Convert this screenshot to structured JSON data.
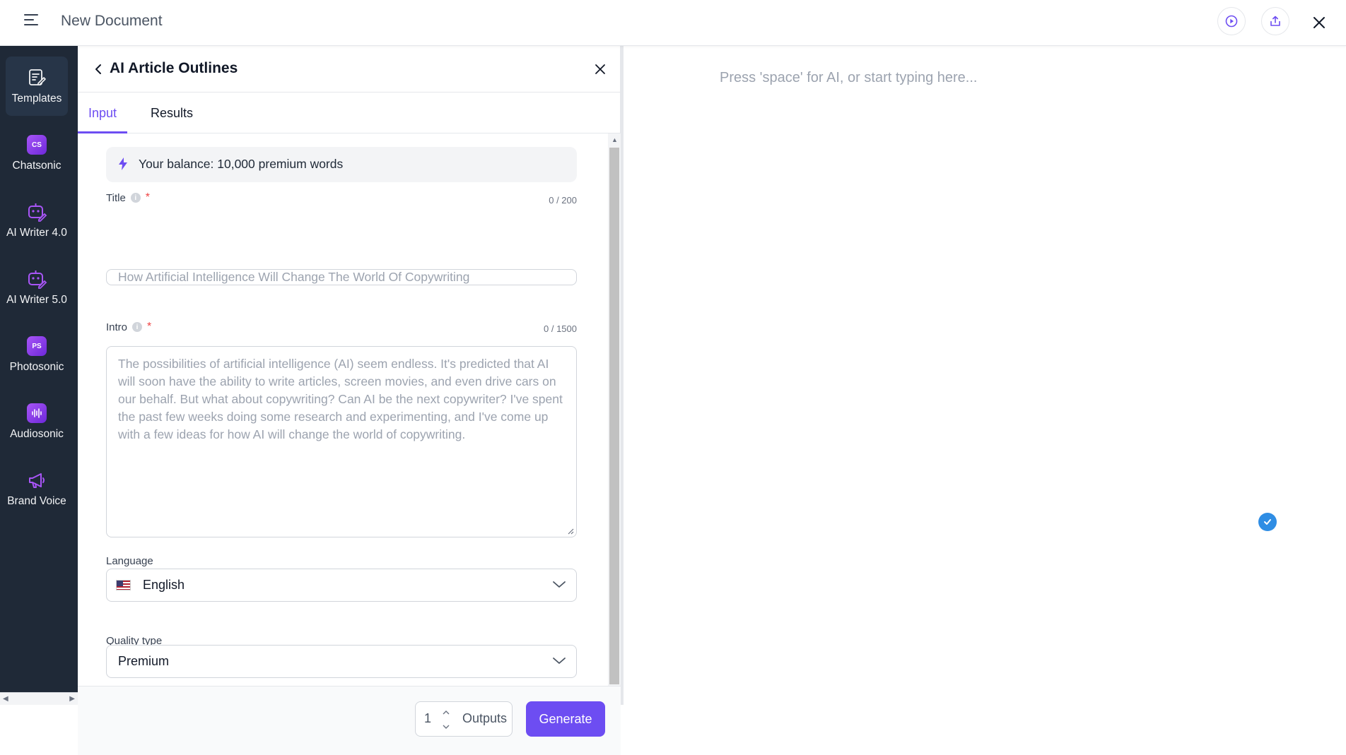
{
  "header": {
    "title": "New Document",
    "icons": [
      "menu-icon",
      "play-icon",
      "share-icon",
      "close-icon"
    ]
  },
  "sidebar": {
    "items": [
      {
        "label": "Templates",
        "icon": "templates-icon",
        "active": true
      },
      {
        "label": "Chatsonic",
        "icon": "cs",
        "active": false
      },
      {
        "label": "AI Writer 4.0",
        "icon": "ai-writer-icon",
        "active": false
      },
      {
        "label": "AI Writer 5.0",
        "icon": "ai-writer-icon",
        "active": false
      },
      {
        "label": "Photosonic",
        "icon": "ps",
        "active": false
      },
      {
        "label": "Audiosonic",
        "icon": "audio-icon",
        "active": false
      },
      {
        "label": "Brand Voice",
        "icon": "megaphone-icon",
        "active": false
      }
    ]
  },
  "panel": {
    "title": "AI Article Outlines",
    "tabs": [
      {
        "label": "Input",
        "active": true
      },
      {
        "label": "Results",
        "active": false
      }
    ],
    "balance": "Your balance: 10,000 premium words",
    "title_field": {
      "label": "Title",
      "required": "*",
      "counter": "0 / 200",
      "placeholder": "How Artificial Intelligence Will Change The World Of Copywriting"
    },
    "intro_field": {
      "label": "Intro",
      "required": "*",
      "counter": "0 / 1500",
      "placeholder": "The possibilities of artificial intelligence (AI) seem endless. It's predicted that AI will soon have the ability to write articles, screen movies, and even drive cars on our behalf. But what about copywriting? Can AI be the next copywriter? I've spent the past few weeks doing some research and experimenting, and I've come up with a few ideas for how AI will change the world of copywriting."
    },
    "language": {
      "label": "Language",
      "value": "English"
    },
    "quality": {
      "label": "Quality type",
      "value": "Premium"
    },
    "footer": {
      "outputs_value": "1",
      "outputs_label": "Outputs",
      "generate_label": "Generate"
    }
  },
  "editor": {
    "placeholder": "Press 'space' for AI, or start typing here..."
  },
  "colors": {
    "accent": "#6d4df2",
    "sidebar_bg": "#1f2937",
    "check": "#2f8de4"
  }
}
